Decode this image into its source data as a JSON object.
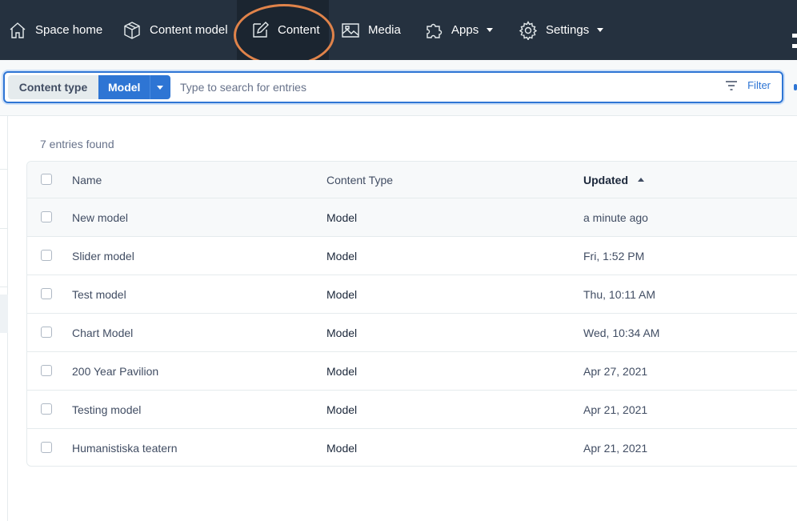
{
  "nav": {
    "items": [
      {
        "label": "Space home",
        "icon": "home-icon"
      },
      {
        "label": "Content model",
        "icon": "cube-icon"
      },
      {
        "label": "Content",
        "icon": "edit-icon",
        "active": true
      },
      {
        "label": "Media",
        "icon": "image-icon"
      },
      {
        "label": "Apps",
        "icon": "puzzle-icon",
        "dropdown": true
      },
      {
        "label": "Settings",
        "icon": "gear-icon",
        "dropdown": true
      }
    ],
    "highlight_color": "#e0834a"
  },
  "search": {
    "content_type_label": "Content type",
    "content_type_value": "Model",
    "placeholder": "Type to search for entries",
    "filter_label": "Filter"
  },
  "results": {
    "count_text": "7 entries found",
    "columns": {
      "name": "Name",
      "content_type": "Content Type",
      "updated": "Updated"
    },
    "rows": [
      {
        "name": "New model",
        "content_type": "Model",
        "updated": "a minute ago"
      },
      {
        "name": "Slider model",
        "content_type": "Model",
        "updated": "Fri, 1:52 PM"
      },
      {
        "name": "Test model",
        "content_type": "Model",
        "updated": "Thu, 10:11 AM"
      },
      {
        "name": "Chart Model",
        "content_type": "Model",
        "updated": "Wed, 10:34 AM"
      },
      {
        "name": "200 Year Pavilion",
        "content_type": "Model",
        "updated": "Apr 27, 2021"
      },
      {
        "name": "Testing model",
        "content_type": "Model",
        "updated": "Apr 21, 2021"
      },
      {
        "name": "Humanistiska teatern",
        "content_type": "Model",
        "updated": "Apr 21, 2021"
      }
    ]
  },
  "colors": {
    "nav_bg": "#25313f",
    "accent": "#2e75d4"
  }
}
